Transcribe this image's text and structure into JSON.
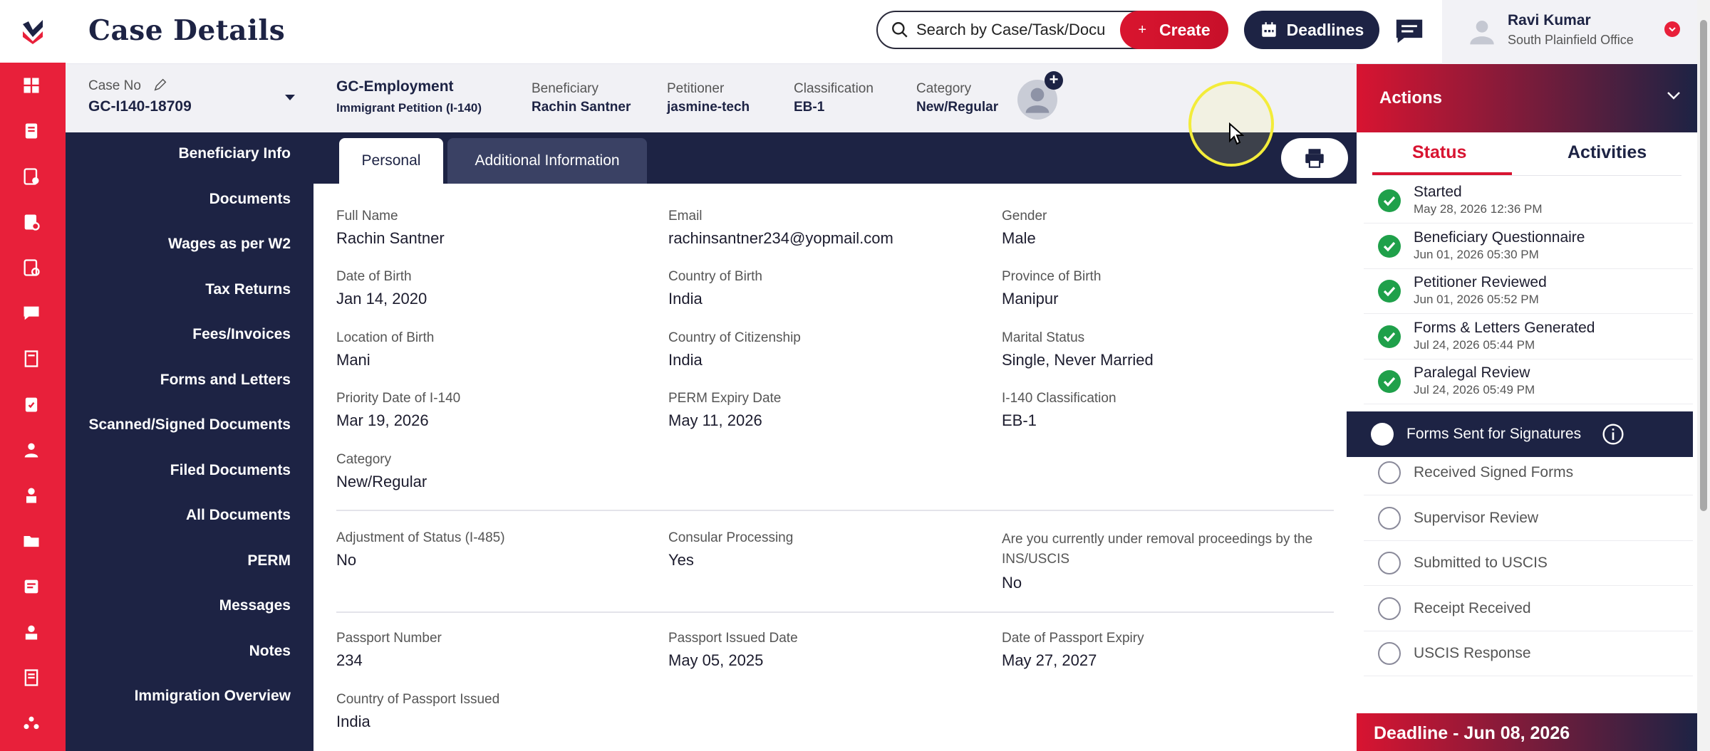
{
  "header": {
    "title": "Case Details",
    "search_placeholder": "Search by Case/Task/Docu",
    "create_label": "Create",
    "deadlines_label": "Deadlines"
  },
  "user": {
    "name": "Ravi Kumar",
    "office": "South Plainfield Office"
  },
  "case": {
    "case_no_label": "Case No",
    "case_no": "GC-I140-18709",
    "type_title": "GC-Employment",
    "type_sub": "Immigrant Petition (I-140)",
    "beneficiary_label": "Beneficiary",
    "beneficiary": "Rachin Santner",
    "petitioner_label": "Petitioner",
    "petitioner": "jasmine-tech",
    "classification_label": "Classification",
    "classification": "EB-1",
    "category_label": "Category",
    "category": "New/Regular"
  },
  "nav": [
    "Beneficiary Info",
    "Documents",
    "Wages as per W2",
    "Tax Returns",
    "Fees/Invoices",
    "Forms and Letters",
    "Scanned/Signed Documents",
    "Filed Documents",
    "All Documents",
    "PERM",
    "Messages",
    "Notes",
    "Immigration Overview"
  ],
  "tabs": {
    "personal": "Personal",
    "additional": "Additional Information"
  },
  "fields": {
    "full_name": {
      "label": "Full Name",
      "value": "Rachin Santner"
    },
    "email": {
      "label": "Email",
      "value": "rachinsantner234@yopmail.com"
    },
    "gender": {
      "label": "Gender",
      "value": "Male"
    },
    "dob": {
      "label": "Date of Birth",
      "value": "Jan 14, 2020"
    },
    "country_birth": {
      "label": "Country of Birth",
      "value": "India"
    },
    "province_birth": {
      "label": "Province of Birth",
      "value": "Manipur"
    },
    "location_birth": {
      "label": "Location of Birth",
      "value": "Mani"
    },
    "citizenship": {
      "label": "Country of Citizenship",
      "value": "India"
    },
    "marital": {
      "label": "Marital Status",
      "value": "Single, Never Married"
    },
    "priority_date": {
      "label": "Priority Date of I-140",
      "value": "Mar 19, 2026"
    },
    "perm_expiry": {
      "label": "PERM Expiry Date",
      "value": "May 11, 2026"
    },
    "i140_class": {
      "label": "I-140 Classification",
      "value": "EB-1"
    },
    "category": {
      "label": "Category",
      "value": "New/Regular"
    },
    "aos": {
      "label": "Adjustment of Status (I-485)",
      "value": "No"
    },
    "consular": {
      "label": "Consular Processing",
      "value": "Yes"
    },
    "removal": {
      "label": "Are you currently under removal proceedings by the INS/USCIS",
      "value": "No"
    },
    "passport_no": {
      "label": "Passport Number",
      "value": "234"
    },
    "passport_issued": {
      "label": "Passport Issued Date",
      "value": "May 05, 2025"
    },
    "passport_expiry": {
      "label": "Date of Passport Expiry",
      "value": "May 27, 2027"
    },
    "passport_country": {
      "label": "Country of Passport Issued",
      "value": "India"
    }
  },
  "actions": {
    "title": "Actions",
    "tab_status": "Status",
    "tab_activities": "Activities",
    "statuses": [
      {
        "name": "Started",
        "date": "May 28, 2026 12:36 PM",
        "state": "done"
      },
      {
        "name": "Beneficiary Questionnaire",
        "date": "Jun 01, 2026 05:30 PM",
        "state": "done"
      },
      {
        "name": "Petitioner Reviewed",
        "date": "Jun 01, 2026 05:52 PM",
        "state": "done"
      },
      {
        "name": "Forms & Letters Generated",
        "date": "Jul 24, 2026 05:44 PM",
        "state": "done"
      },
      {
        "name": "Paralegal Review",
        "date": "Jul 24, 2026 05:49 PM",
        "state": "done"
      },
      {
        "name": "Forms Sent for Signatures",
        "state": "current"
      },
      {
        "name": "Received Signed Forms",
        "state": "todo"
      },
      {
        "name": "Supervisor Review",
        "state": "todo"
      },
      {
        "name": "Submitted to USCIS",
        "state": "todo"
      },
      {
        "name": "Receipt Received",
        "state": "todo"
      },
      {
        "name": "USCIS Response",
        "state": "todo"
      }
    ],
    "deadline": "Deadline - Jun 08, 2026"
  },
  "colors": {
    "brand_red": "#e8203a",
    "navy": "#1d2344",
    "done_green": "#1fa04a"
  }
}
